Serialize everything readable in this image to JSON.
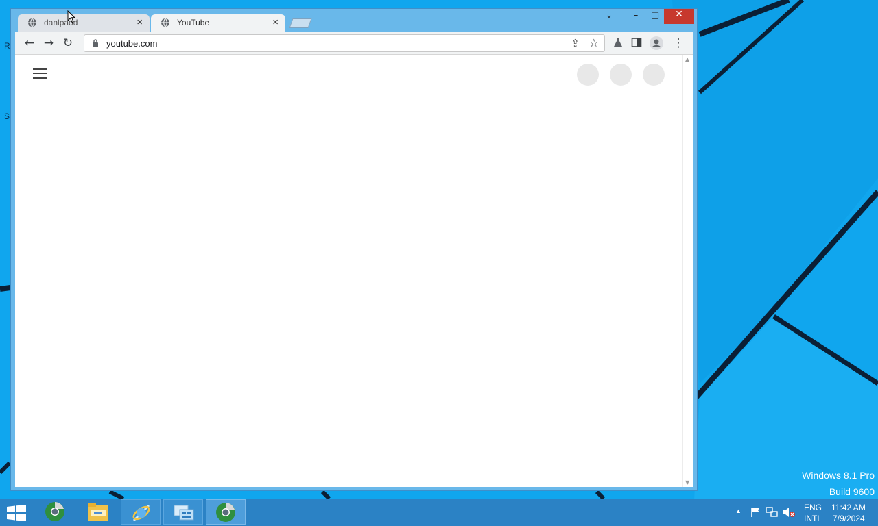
{
  "desktop": {
    "watermark_line1": "Windows 8.1 Pro",
    "watermark_line2": "Build 9600",
    "edge_letters": [
      "R",
      "S"
    ]
  },
  "browser": {
    "tabs": [
      {
        "label": "danlpaod",
        "icon": "globe-icon",
        "active": false
      },
      {
        "label": "YouTube",
        "icon": "globe-icon",
        "active": true
      }
    ],
    "window_controls": {
      "chevron": "⌄",
      "minimize": "–",
      "maximize": "□",
      "close": "✕"
    },
    "toolbar": {
      "back": "←",
      "forward": "→",
      "reload": "↻",
      "url": "youtube.com",
      "share_icon": "share-icon",
      "star_icon": "star-icon",
      "extensions_icon": "flask-icon",
      "sidepanel_icon": "side-panel-icon",
      "profile_icon": "profile-icon",
      "menu": "⋮"
    },
    "page": {
      "hamburger_icon": "menu-icon",
      "placeholders": 3
    }
  },
  "taskbar": {
    "apps": [
      {
        "name": "start-button"
      },
      {
        "name": "chrome-icon"
      },
      {
        "name": "file-explorer-icon"
      },
      {
        "name": "internet-explorer-icon"
      },
      {
        "name": "network-settings-icon"
      },
      {
        "name": "chrome-canary-icon"
      }
    ],
    "tray": {
      "lang_top": "ENG",
      "lang_bottom": "INTL",
      "time": "11:42 AM",
      "date": "7/9/2024"
    }
  },
  "colors": {
    "desktop_blue": "#10a6ee",
    "window_frame": "#69b8ea",
    "close_red": "#c7382d",
    "taskbar": "#2b82c5"
  }
}
